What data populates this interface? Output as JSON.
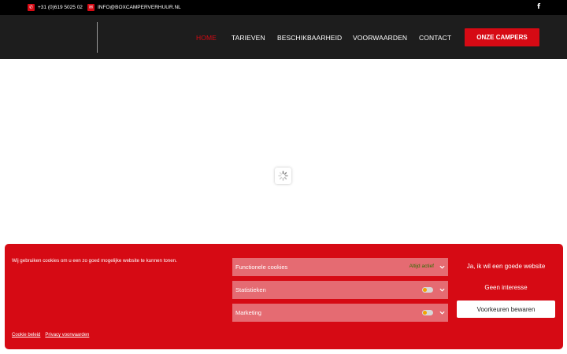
{
  "topbar": {
    "phone": "+31 (0)619 5025 02",
    "email": "INFO@BOXCAMPERVERHUUR.NL",
    "social_icon": "facebook-icon",
    "social_glyph": "f"
  },
  "nav": {
    "items": [
      "HOME",
      "TARIEVEN",
      "BESCHIKBAARHEID",
      "VOORWAARDEN",
      "CONTACT"
    ],
    "active": "HOME",
    "cta": "ONZE CAMPERS"
  },
  "cookie": {
    "message": "Wij gebruiken cookies om u een zo goed mogelijke website te kunnen tonen.",
    "categories": [
      {
        "label": "Functionele cookies",
        "status": "Altijd actief"
      },
      {
        "label": "Statistieken",
        "status": ""
      },
      {
        "label": "Marketing",
        "status": ""
      }
    ],
    "accept": "Ja, ik wil een goede website",
    "deny": "Geen interesse",
    "save": "Voorkeuren bewaren",
    "links": [
      "Cookie beleid",
      "Privacy voorwaarden"
    ]
  },
  "colors": {
    "brand_red": "#d60a14",
    "nav_bg": "#1d1d1d",
    "category_bg": "#e56b72"
  }
}
